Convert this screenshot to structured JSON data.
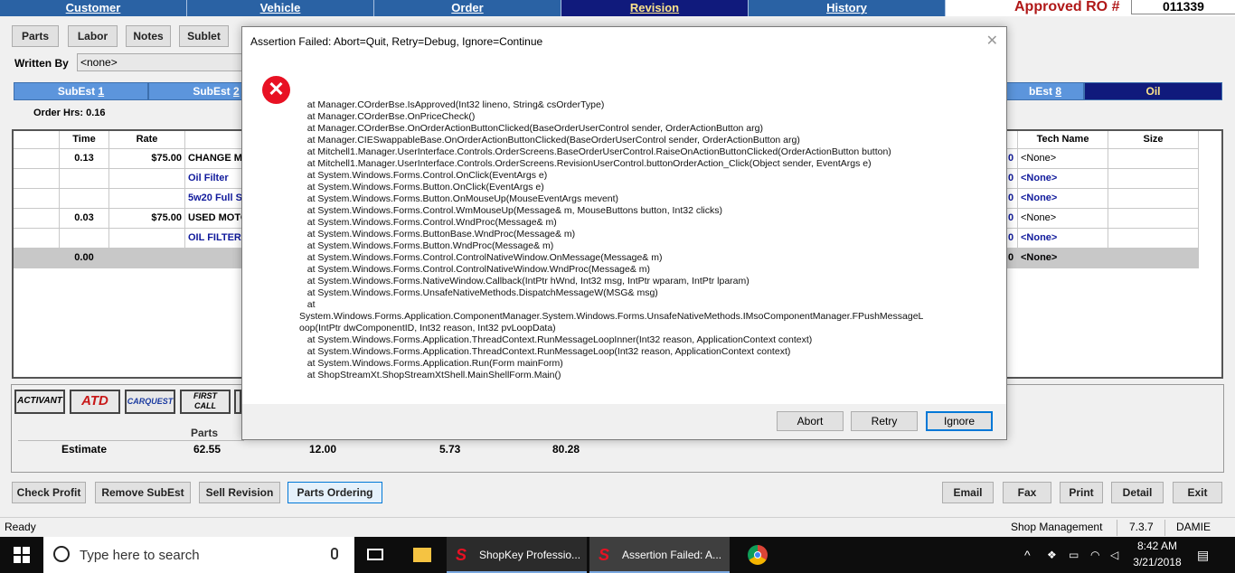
{
  "top_tabs": [
    {
      "label": "Customer",
      "active": false
    },
    {
      "label": "Vehicle",
      "active": false
    },
    {
      "label": "Order",
      "active": false
    },
    {
      "label": "Revision",
      "active": true
    },
    {
      "label": "History",
      "active": false
    }
  ],
  "approved_ro": {
    "label": "Approved RO #",
    "value": "011339"
  },
  "toolbar": {
    "parts": "Parts",
    "labor": "Labor",
    "notes": "Notes",
    "sublet": "Sublet"
  },
  "written_by": {
    "label": "Written By",
    "value": "<none>"
  },
  "subest_tabs": {
    "subest1": {
      "prefix": "SubEst ",
      "num": "1"
    },
    "subest2": {
      "prefix": "SubEst ",
      "num": "2"
    },
    "subest8": {
      "prefix": "bEst ",
      "num": "8"
    },
    "oil": "Oil"
  },
  "order_hrs": "Order Hrs: 0.16",
  "grid": {
    "headers": {
      "time": "Time",
      "rate": "Rate",
      "tech_name": "Tech Name",
      "size": "Size"
    },
    "rows": [
      {
        "time": "0.13",
        "rate": "$75.00",
        "desc": "CHANGE MO",
        "qty": "0",
        "tech": "<None>",
        "style": "bold"
      },
      {
        "time": "",
        "rate": "",
        "desc": "Oil Filter",
        "qty": "0",
        "tech": "<None>",
        "style": "blue"
      },
      {
        "time": "",
        "rate": "",
        "desc": "5w20 Full S",
        "qty": "0",
        "tech": "<None>",
        "style": "blue"
      },
      {
        "time": "0.03",
        "rate": "$75.00",
        "desc": "USED MOTO",
        "qty": "0",
        "tech": "<None>",
        "style": "bold"
      },
      {
        "time": "",
        "rate": "",
        "desc": "OIL FILTER /",
        "qty": "0",
        "tech": "<None>",
        "style": "blue"
      },
      {
        "time": "0.00",
        "rate": "",
        "desc": "",
        "qty": "0",
        "tech": "<None>",
        "style": "grey"
      }
    ]
  },
  "vendors": [
    "ACTIVANT",
    "ATD",
    "CARQUEST",
    "FIRST CALL"
  ],
  "totals": {
    "parts_label": "Parts",
    "estimate_label": "Estimate",
    "v1": "62.55",
    "v2": "12.00",
    "v3": "5.73",
    "v4": "80.28"
  },
  "bottom_buttons": {
    "check_profit": "Check Profit",
    "remove_subest": "Remove SubEst",
    "sell_revision": "Sell Revision",
    "parts_ordering": "Parts Ordering",
    "email": "Email",
    "fax": "Fax",
    "print": "Print",
    "detail": "Detail",
    "exit": "Exit"
  },
  "status_bar": {
    "status": "Ready",
    "module": "Shop Management",
    "version": "7.3.7",
    "user": "DAMIE"
  },
  "dialog": {
    "title": "Assertion Failed: Abort=Quit, Retry=Debug, Ignore=Continue",
    "stack": "   at Manager.COrderBse.IsApproved(Int32 lineno, String& csOrderType)\n   at Manager.COrderBse.OnPriceCheck()\n   at Manager.COrderBse.OnOrderActionButtonClicked(BaseOrderUserControl sender, OrderActionButton arg)\n   at Manager.CIESwappableBase.OnOrderActionButtonClicked(BaseOrderUserControl sender, OrderActionButton arg)\n   at Mitchell1.Manager.UserInterface.Controls.OrderScreens.BaseOrderUserControl.RaiseOnActionButtonClicked(OrderActionButton button)\n   at Mitchell1.Manager.UserInterface.Controls.OrderScreens.RevisionUserControl.buttonOrderAction_Click(Object sender, EventArgs e)\n   at System.Windows.Forms.Control.OnClick(EventArgs e)\n   at System.Windows.Forms.Button.OnClick(EventArgs e)\n   at System.Windows.Forms.Button.OnMouseUp(MouseEventArgs mevent)\n   at System.Windows.Forms.Control.WmMouseUp(Message& m, MouseButtons button, Int32 clicks)\n   at System.Windows.Forms.Control.WndProc(Message& m)\n   at System.Windows.Forms.ButtonBase.WndProc(Message& m)\n   at System.Windows.Forms.Button.WndProc(Message& m)\n   at System.Windows.Forms.Control.ControlNativeWindow.OnMessage(Message& m)\n   at System.Windows.Forms.Control.ControlNativeWindow.WndProc(Message& m)\n   at System.Windows.Forms.NativeWindow.Callback(IntPtr hWnd, Int32 msg, IntPtr wparam, IntPtr lparam)\n   at System.Windows.Forms.UnsafeNativeMethods.DispatchMessageW(MSG& msg)\n   at\nSystem.Windows.Forms.Application.ComponentManager.System.Windows.Forms.UnsafeNativeMethods.IMsoComponentManager.FPushMessageL\noop(IntPtr dwComponentID, Int32 reason, Int32 pvLoopData)\n   at System.Windows.Forms.Application.ThreadContext.RunMessageLoopInner(Int32 reason, ApplicationContext context)\n   at System.Windows.Forms.Application.ThreadContext.RunMessageLoop(Int32 reason, ApplicationContext context)\n   at System.Windows.Forms.Application.Run(Form mainForm)\n   at ShopStreamXt.ShopStreamXtShell.MainShellForm.Main()",
    "buttons": {
      "abort": "Abort",
      "retry": "Retry",
      "ignore": "Ignore"
    }
  },
  "taskbar": {
    "search_placeholder": "Type here to search",
    "app1": "ShopKey Professio...",
    "app2": "Assertion Failed: A...",
    "time": "8:42 AM",
    "date": "3/21/2018"
  },
  "colors": {
    "tab_blue": "#2a62a4",
    "tab_active": "#101a7c",
    "subtab_blue": "#5c95dc",
    "error_red": "#e81123",
    "ro_red": "#b01818"
  }
}
